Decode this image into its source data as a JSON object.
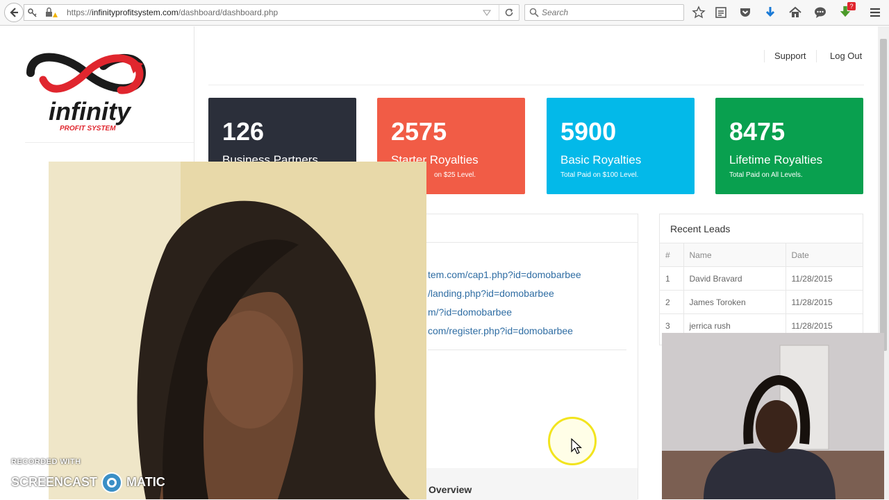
{
  "browser": {
    "url_prefix": "https://",
    "url_host": "infinityprofitsystem.com",
    "url_path": "/dashboard/dashboard.php",
    "search_placeholder": "Search",
    "notification_count": "?"
  },
  "brand": {
    "name": "infinity",
    "tagline": "PROFIT SYSTEM",
    "colors": {
      "red": "#e0262e",
      "black": "#1b1b1b"
    }
  },
  "nav": {
    "support": "Support",
    "logout": "Log Out"
  },
  "stats": [
    {
      "value": "126",
      "title": "Business Partners",
      "subtitle": "",
      "color": "#2b2f3a"
    },
    {
      "value": "2575",
      "title": "Starter Royalties",
      "subtitle": "on $25 Level.",
      "color": "#f15c46"
    },
    {
      "value": "5900",
      "title": "Basic Royalties",
      "subtitle": "Total Paid on $100 Level.",
      "color": "#03b9e9"
    },
    {
      "value": "8475",
      "title": "Lifetime Royalties",
      "subtitle": "Total Paid on All Levels.",
      "color": "#09a04f"
    }
  ],
  "links": [
    "tem.com/cap1.php?id=domobarbee",
    "/landing.php?id=domobarbee",
    "m/?id=domobarbee",
    "com/register.php?id=domobarbee"
  ],
  "overview_label": "Overview",
  "recent_leads": {
    "title": "Recent Leads",
    "headers": [
      "#",
      "Name",
      "Date"
    ],
    "rows": [
      [
        "1",
        "David Bravard",
        "11/28/2015"
      ],
      [
        "2",
        "James Toroken",
        "11/28/2015"
      ],
      [
        "3",
        "jerrica rush",
        "11/28/2015"
      ]
    ]
  },
  "watermark": {
    "line1": "RECORDED WITH",
    "line2a": "SCREENCAST",
    "line2b": "MATIC"
  }
}
